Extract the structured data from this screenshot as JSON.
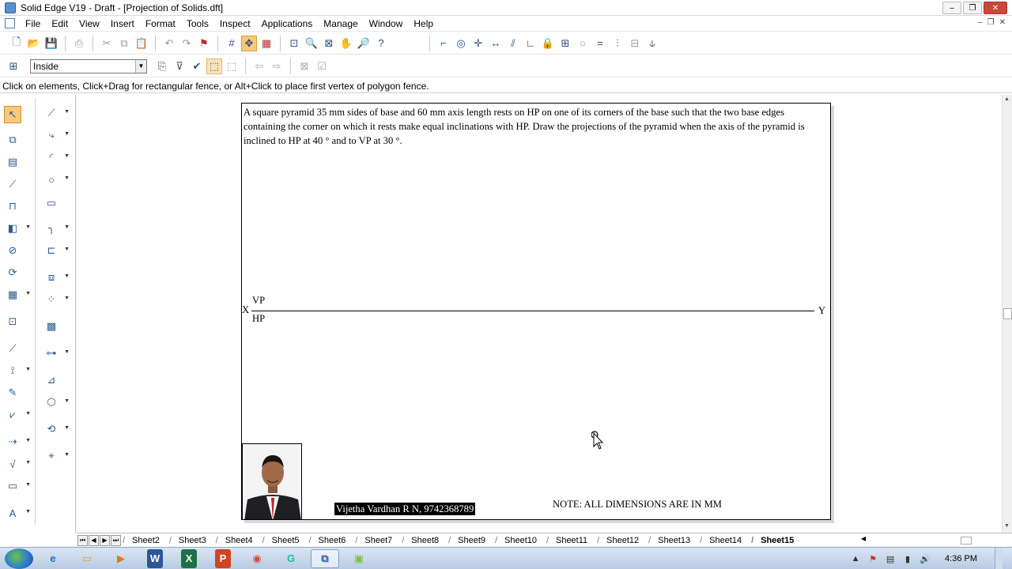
{
  "window": {
    "title": "Solid Edge V19 - Draft - [Projection of Solids.dft]",
    "controls": [
      "–",
      "❐",
      "✕"
    ]
  },
  "menubar": {
    "items": [
      "File",
      "Edit",
      "View",
      "Insert",
      "Format",
      "Tools",
      "Inspect",
      "Applications",
      "Manage",
      "Window",
      "Help"
    ]
  },
  "selection_toolbar": {
    "filter_value": "Inside"
  },
  "prompt_bar": {
    "text": "Click on elements, Click+Drag for rectangular fence, or Alt+Click to place first vertex of polygon fence."
  },
  "drawing": {
    "problem_text": "A square pyramid 35 mm sides of base and 60 mm axis length rests on HP on one of its corners of the base such that the two base edges containing the corner on which it rests make equal inclinations with HP. Draw the projections of the pyramid when the axis of the pyramid is inclined to HP at 40 ° and to VP at 30 °.",
    "x_label": "X",
    "y_label": "Y",
    "vp_label": "VP",
    "hp_label": "HP",
    "author": "Vijetha Vardhan R N, 9742368789",
    "note": "NOTE: ALL DIMENSIONS ARE IN MM"
  },
  "sheet_tabs": {
    "tabs": [
      "Sheet2",
      "Sheet3",
      "Sheet4",
      "Sheet5",
      "Sheet6",
      "Sheet7",
      "Sheet8",
      "Sheet9",
      "Sheet10",
      "Sheet11",
      "Sheet12",
      "Sheet13",
      "Sheet14",
      "Sheet15"
    ],
    "active": "Sheet15"
  },
  "taskbar": {
    "apps": [
      "ie",
      "explorer",
      "media",
      "W",
      "X",
      "P",
      "chrome",
      "grammarly",
      "solidedge",
      "files"
    ],
    "clock": "4:36 PM"
  },
  "colors": {
    "active_tool": "#f7c97a",
    "author_bg": "#000000"
  }
}
